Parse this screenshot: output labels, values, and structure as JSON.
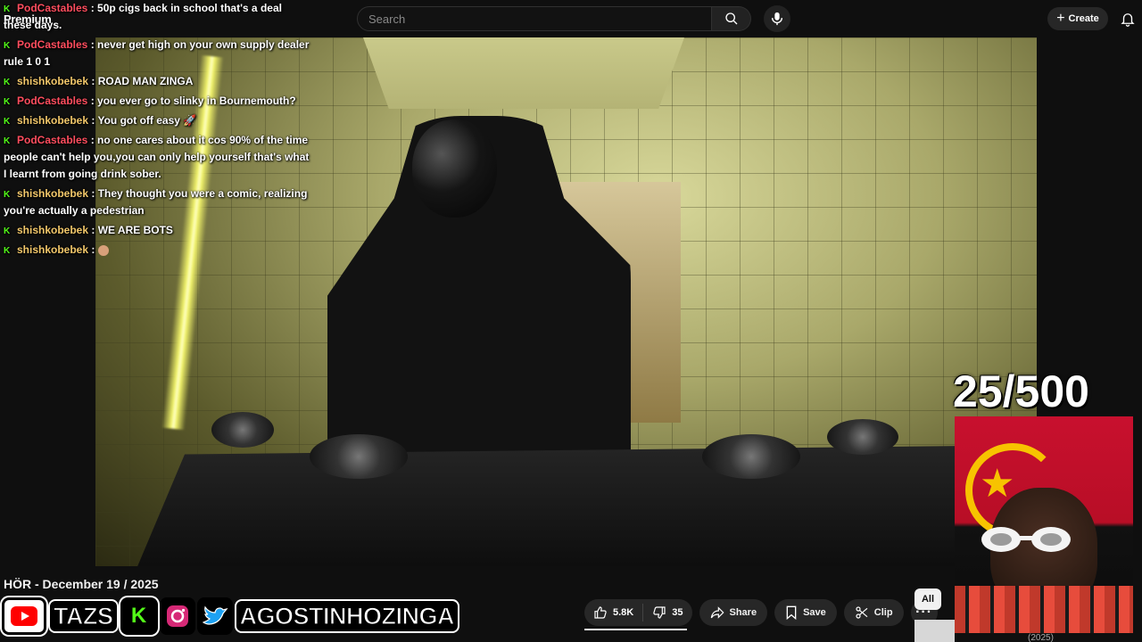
{
  "header": {
    "logo_text": "Premium",
    "search_placeholder": "Search",
    "create_label": "Create"
  },
  "chat": {
    "messages": [
      {
        "user": "PodCastables",
        "text": "50p cigs back in school that's a deal these days.",
        "color": "#ff4d5e"
      },
      {
        "user": "PodCastables",
        "text": "never get high on your own supply dealer rule 1 0 1",
        "color": "#ff4d5e"
      },
      {
        "user": "shishkobebek",
        "text": "ROAD MAN ZINGA",
        "color": "#f2c76a"
      },
      {
        "user": "PodCastables",
        "text": "you ever go to slinky in Bournemouth?",
        "color": "#ff4d5e"
      },
      {
        "user": "shishkobebek",
        "text": "You got off easy",
        "color": "#f2c76a"
      },
      {
        "user": "PodCastables",
        "text": "no one cares about it cos 90% of the time people can't help you,you can only help yourself that's what I learnt from going drink sober.",
        "color": "#ff4d5e"
      },
      {
        "user": "shishkobebek",
        "text": "They thought you were a comic, realizing you're actually a pedestrian",
        "color": "#f2c76a"
      },
      {
        "user": "shishkobebek",
        "text": "WE ARE BOTS",
        "color": "#f2c76a"
      },
      {
        "user": "shishkobebek",
        "text": "",
        "color": "#f2c76a"
      }
    ]
  },
  "overlay": {
    "counter": "25/500"
  },
  "video": {
    "title": "HÖR - December 19 / 2025",
    "progress_fraction": 0.11
  },
  "socials": {
    "name_1": "TAZS",
    "name_2": "AGOSTINHOZINGA"
  },
  "actions": {
    "likes": "5.8K",
    "dislikes": "35",
    "share": "Share",
    "save": "Save",
    "clip": "Clip"
  },
  "sidebar": {
    "chip_all": "All",
    "year": "(2025)"
  },
  "colors": {
    "kick_green": "#53fc18",
    "youtube_red": "#ff0000",
    "accent": "#f1f1f1"
  }
}
